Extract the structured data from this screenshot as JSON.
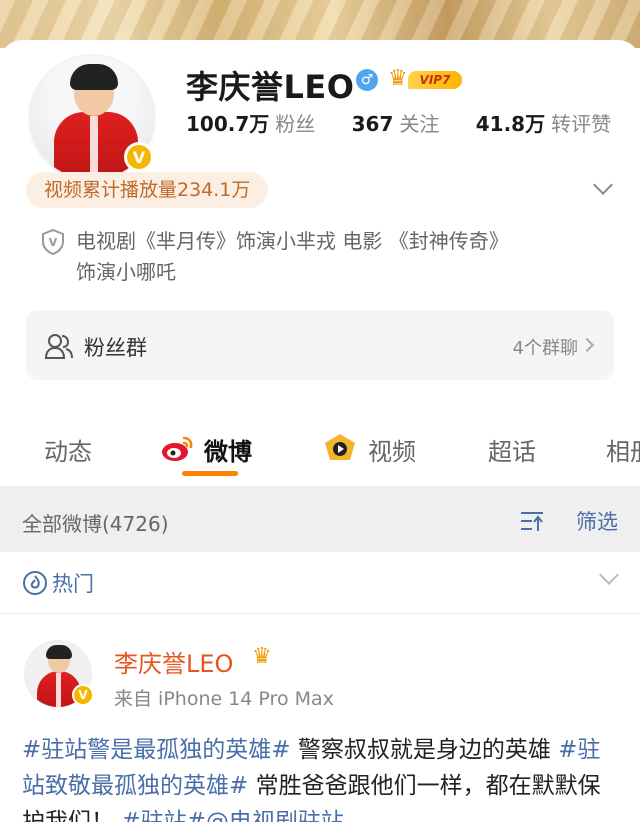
{
  "profile": {
    "name": "李庆誉LEO",
    "vip_label": "VIP7",
    "stats": [
      {
        "value": "100.7万",
        "label": "粉丝"
      },
      {
        "value": "367",
        "label": "关注"
      },
      {
        "value": "41.8万",
        "label": "转评赞"
      }
    ],
    "play_count": "视频累计播放量234.1万",
    "bio_line1": "电视剧《芈月传》饰演小芈戎 电影 《封神传奇》",
    "bio_line2": "饰演小哪吒"
  },
  "fans_group": {
    "label": "粉丝群",
    "count": "4个群聊"
  },
  "tabs": [
    {
      "label": "动态"
    },
    {
      "label": "微博"
    },
    {
      "label": "视频"
    },
    {
      "label": "超话"
    },
    {
      "label": "相册"
    }
  ],
  "feed_bar": {
    "count_label": "全部微博(4726)",
    "filter_label": "筛选"
  },
  "hot": {
    "label": "热门"
  },
  "post": {
    "author": "李庆誉LEO",
    "source": "来自 iPhone 14 Pro Max",
    "segments": [
      {
        "text": "#驻站警是最孤独的英雄#",
        "hashtag": true
      },
      {
        "text": " 警察叔叔就是身边的英雄 ",
        "hashtag": false
      },
      {
        "text": "#驻站致敬最孤独的英雄#",
        "hashtag": true
      },
      {
        "text": " 常胜爸爸跟他们一样，都在默默保护我们！ ",
        "hashtag": false
      },
      {
        "text": "#驻站#",
        "hashtag": true
      },
      {
        "text": "@电视剧驻站",
        "hashtag": true
      }
    ]
  },
  "colors": {
    "accent_orange": "#ff8200",
    "link_blue": "#4a6ea9",
    "author_orange": "#e8541e",
    "verified_gold": "#f6b600"
  }
}
